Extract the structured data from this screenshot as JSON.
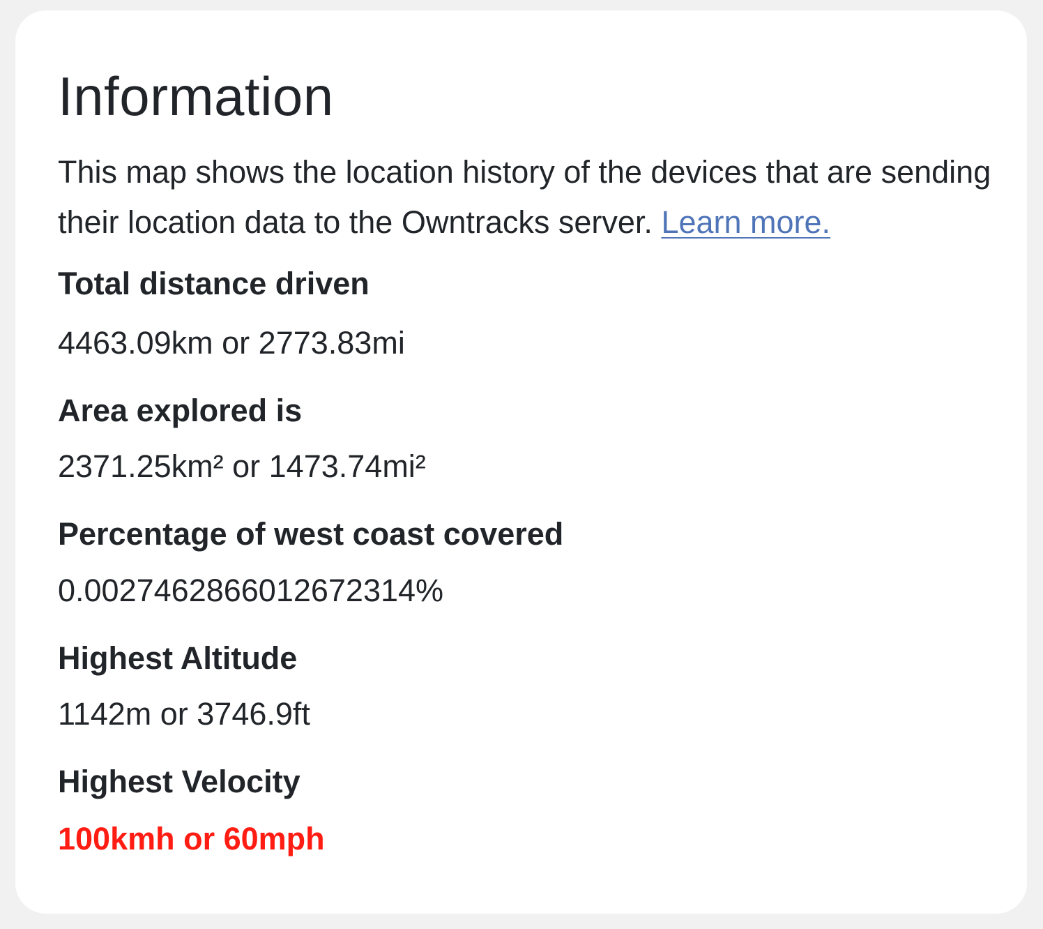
{
  "info_panel": {
    "title": "Information",
    "description": "This map shows the location history of the devices that are sending their location data to the Owntracks server.",
    "learn_more_link": "Learn more.",
    "stats": {
      "distance": {
        "label": "Total distance driven",
        "value": "4463.09km or 2773.83mi"
      },
      "area": {
        "label": "Area explored is",
        "value": "2371.25km² or 1473.74mi²"
      },
      "coverage": {
        "label": "Percentage of west coast covered",
        "value": "0.0027462866012672314%"
      },
      "altitude": {
        "label": "Highest Altitude",
        "value": "1142m or 3746.9ft"
      },
      "velocity": {
        "label": "Highest Velocity",
        "value": "100kmh or 60mph"
      }
    }
  },
  "colors": {
    "background": "#f1f1f1",
    "card": "#ffffff",
    "text": "#212529",
    "link": "#4f75b8",
    "alert": "#ff1c12"
  }
}
